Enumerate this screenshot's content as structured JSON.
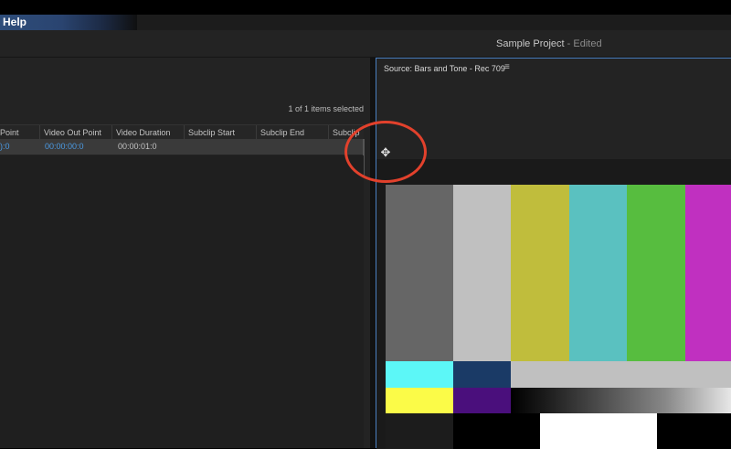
{
  "menu": {
    "help_label": "Help"
  },
  "title": {
    "project_name": "Sample Project",
    "state": " - Edited"
  },
  "project_panel": {
    "items_selected": "1 of 1 items selected",
    "columns": [
      "Point",
      "Video Out Point",
      "Video Duration",
      "Subclip Start",
      "Subclip End",
      "Subclip"
    ],
    "row": {
      "in_point": "):0",
      "out_point": "00:00:00:0",
      "duration": "00:00:01:0"
    }
  },
  "source": {
    "tab_label": "Source: Bars and Tone - Rec 709",
    "menu_icon": "hamburger-icon",
    "top_bars": [
      "#666666",
      "#c0c0c0",
      "#c0bd3c",
      "#5ac1c0",
      "#57bd3f",
      "#c030c0"
    ],
    "mid_bars": [
      "#5cf7f7",
      "#1a3a66",
      "#c0c0c0"
    ],
    "low_bars": [
      "#fbfb48",
      "#4a0f7c"
    ],
    "bottom_row": [
      "#1c1c1c",
      "#000000",
      "#ffffff",
      "#000000"
    ]
  },
  "cursor": {
    "icon": "move-cursor-icon"
  },
  "annotation": {
    "color": "#e2412c"
  }
}
